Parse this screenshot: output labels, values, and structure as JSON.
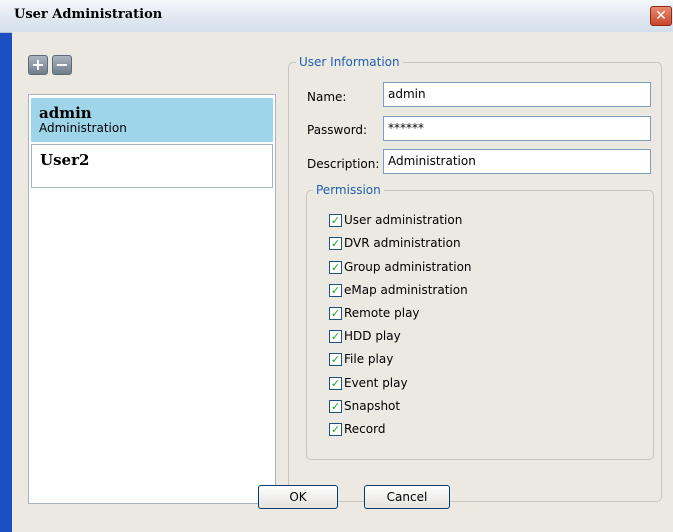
{
  "window": {
    "title": "User Administration",
    "close_label": "✕"
  },
  "toolbar": {
    "add_label": "+",
    "remove_label": "−"
  },
  "users": [
    {
      "name": "admin",
      "description": "Administration",
      "selected": true
    },
    {
      "name": "User2",
      "description": "",
      "selected": false
    }
  ],
  "user_info": {
    "legend": "User Information",
    "name_label": "Name:",
    "name_value": "admin",
    "password_label": "Password:",
    "password_value": "******",
    "description_label": "Description:",
    "description_value": "Administration"
  },
  "permission": {
    "legend": "Permission",
    "check_glyph": "✓",
    "items": [
      {
        "label": "User administration",
        "checked": true
      },
      {
        "label": "DVR administration",
        "checked": true
      },
      {
        "label": "Group administration",
        "checked": true
      },
      {
        "label": "eMap administration",
        "checked": true
      },
      {
        "label": "Remote play",
        "checked": true
      },
      {
        "label": "HDD play",
        "checked": true
      },
      {
        "label": "File play",
        "checked": true
      },
      {
        "label": "Event play",
        "checked": true
      },
      {
        "label": "Snapshot",
        "checked": true
      },
      {
        "label": "Record",
        "checked": true
      }
    ]
  },
  "buttons": {
    "ok_label": "OK",
    "cancel_label": "Cancel"
  },
  "colors": {
    "selected_item": "#9fd5e8",
    "legend_text": "#1f5fb0",
    "window_frame": "#1b4fc4"
  }
}
